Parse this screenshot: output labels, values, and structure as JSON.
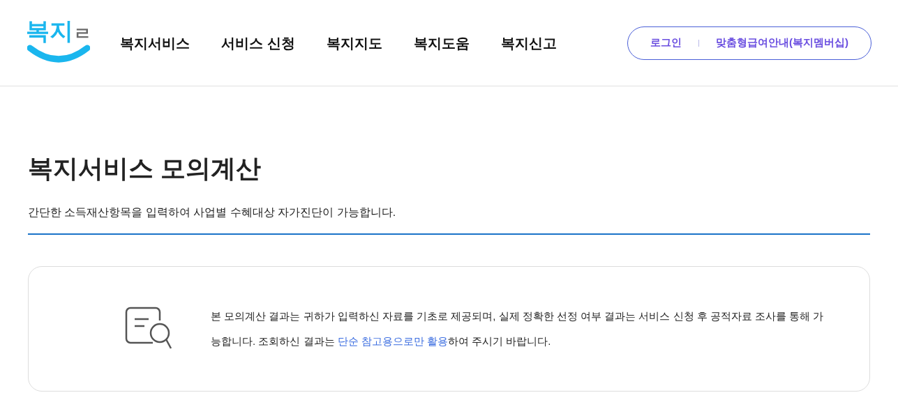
{
  "logo": {
    "part_1": "복지",
    "part_2": "ㄹ"
  },
  "nav": [
    {
      "label": "복지서비스"
    },
    {
      "label": "서비스 신청"
    },
    {
      "label": "복지지도"
    },
    {
      "label": "복지도움"
    },
    {
      "label": "복지신고"
    }
  ],
  "account_links": [
    "로그인",
    "맞춤형급여안내(복지멤버십)"
  ],
  "page": {
    "title": "복지서비스 모의계산",
    "subtitle": "간단한 소득재산항목을 입력하여 사업별 수혜대상 자가진단이 가능합니다."
  },
  "notice": {
    "text_before": "본 모의계산 결과는 귀하가 입력하신 자료를 기초로 제공되며, 실제 정확한 선정 여부 결과는 서비스 신청 후 공적자료 조사를 통해 가능합니다. 조회하신 결과는 ",
    "link": "단순 참고용으로만 활용",
    "text_after": "하여 주시기 바랍니다."
  }
}
